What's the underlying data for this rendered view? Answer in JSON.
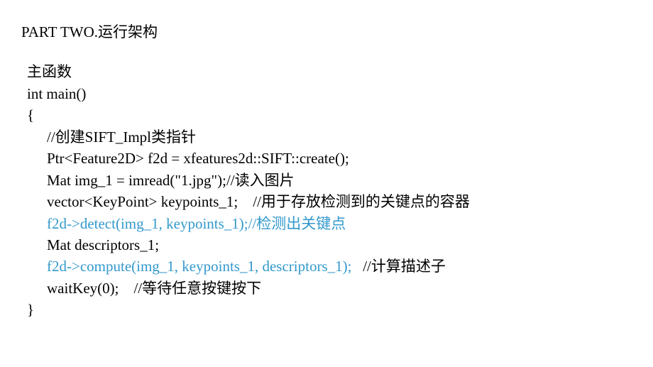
{
  "title": "PART TWO.运行架构",
  "code": {
    "l1": "主函数",
    "l2": "int main()",
    "l3": "{",
    "l4": "//创建SIFT_Impl类指针",
    "l5": "Ptr<Feature2D> f2d = xfeatures2d::SIFT::create();",
    "l6": "Mat img_1 = imread(\"1.jpg\");//读入图片",
    "l7": "vector<KeyPoint> keypoints_1;    //用于存放检测到的关键点的容器",
    "l8": "f2d->detect(img_1, keypoints_1);//检测出关键点",
    "l9": "Mat descriptors_1;",
    "l10a": "f2d->compute(img_1, keypoints_1, descriptors_1);",
    "l10b": "   //计算描述子",
    "l11": "waitKey(0);    //等待任意按键按下",
    "l12": "}"
  }
}
